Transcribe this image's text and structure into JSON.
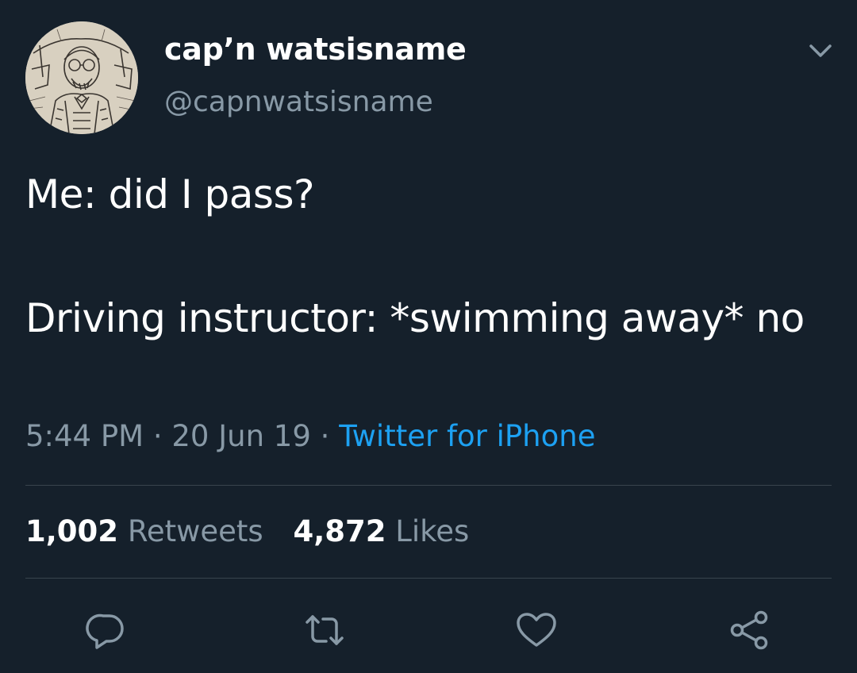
{
  "user": {
    "display_name": "cap’n watsisname",
    "handle": "@capnwatsisname",
    "avatar_icon": "sketch-portrait-avatar"
  },
  "tweet": {
    "text": "Me: did I pass?\n\nDriving instructor: *swimming away* no",
    "time": "5:44 PM",
    "separator": " · ",
    "date": "20 Jun 19",
    "source": "Twitter for iPhone"
  },
  "stats": {
    "retweets_count": "1,002",
    "retweets_label": "Retweets",
    "likes_count": "4,872",
    "likes_label": "Likes"
  },
  "actions": {
    "reply_icon": "reply-icon",
    "retweet_icon": "retweet-icon",
    "like_icon": "heart-icon",
    "share_icon": "share-icon"
  },
  "colors": {
    "background": "#15202b",
    "primary_text": "#ffffff",
    "secondary_text": "#8899a6",
    "accent": "#1da1f2",
    "divider": "#38444d"
  }
}
